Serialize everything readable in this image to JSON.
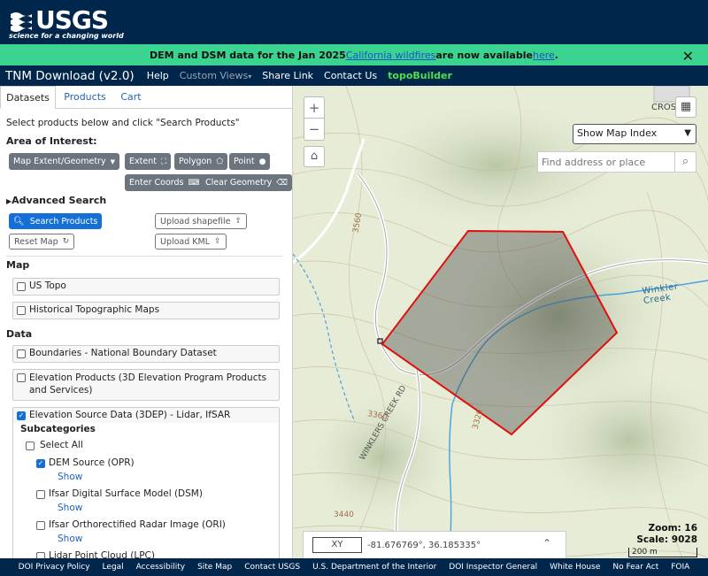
{
  "header": {
    "logo_text": "USGS",
    "logo_tagline": "science for a changing world"
  },
  "alert": {
    "text_before": "DEM and DSM data for the Jan 2025 ",
    "link1": "California wildfires",
    "text_middle": " are now available ",
    "link2": "here",
    "text_after": ".",
    "close": "✕"
  },
  "nav": {
    "brand": "TNM Download (v2.0)",
    "items": [
      "Help",
      "Custom Views",
      "Share Link",
      "Contact Us"
    ],
    "custom_views_caret": "▾",
    "topo_builder": "topoBuilder"
  },
  "tabs": [
    "Datasets",
    "Products",
    "Cart"
  ],
  "intro": "Select products below and click \"Search Products\"",
  "area_of_interest": {
    "label": "Area of Interest:",
    "map_extent": "Map Extent/Geometry",
    "extent": "Extent",
    "polygon": "Polygon",
    "point": "Point",
    "enter_coords": "Enter Coords",
    "clear_geometry": "Clear Geometry"
  },
  "advanced_search": "Advanced Search",
  "actions": {
    "search_products": "Search Products",
    "upload_shapefile": "Upload shapefile",
    "reset_map": "Reset Map",
    "upload_kml": "Upload KML"
  },
  "map_section": {
    "label": "Map",
    "items": [
      "US Topo",
      "Historical Topographic Maps"
    ]
  },
  "data_section": {
    "label": "Data",
    "items": [
      "Boundaries - National Boundary Dataset",
      "Elevation Products (3D Elevation Program Products and Services)",
      "Elevation Source Data (3DEP) - Lidar, IfSAR"
    ]
  },
  "subcategories": {
    "label": "Subcategories",
    "select_all": "Select All",
    "items": [
      {
        "label": "DEM Source (OPR)",
        "checked": true,
        "show": "Show"
      },
      {
        "label": "Ifsar Digital Surface Model (DSM)",
        "checked": false,
        "show": "Show"
      },
      {
        "label": "Ifsar Orthorectified Radar Image (ORI)",
        "checked": false,
        "show": "Show"
      },
      {
        "label": "Lidar Point Cloud (LPC)",
        "checked": false,
        "show": ""
      }
    ]
  },
  "map": {
    "zoom_in": "+",
    "zoom_out": "−",
    "index_select": "Show Map Index",
    "search_placeholder": "Find address or place",
    "xy_label": "XY",
    "coordinates": "-81.676769°, 36.185335°",
    "zoom_text": "Zoom: 16",
    "scale_text": "Scale: 9028",
    "scalebar_text": "200 m",
    "labels": {
      "creek": "Winkler Creek",
      "road": "WINKLERS CREEK RD",
      "cross": "CROSS",
      "c3560": "3560",
      "c3360": "3360",
      "c3320": "3320",
      "c3440": "3440"
    },
    "polygon_color": "#e01010"
  },
  "footer": [
    "DOI Privacy Policy",
    "Legal",
    "Accessibility",
    "Site Map",
    "Contact USGS",
    "U.S. Department of the Interior",
    "DOI Inspector General",
    "White House",
    "No Fear Act",
    "FOIA"
  ]
}
